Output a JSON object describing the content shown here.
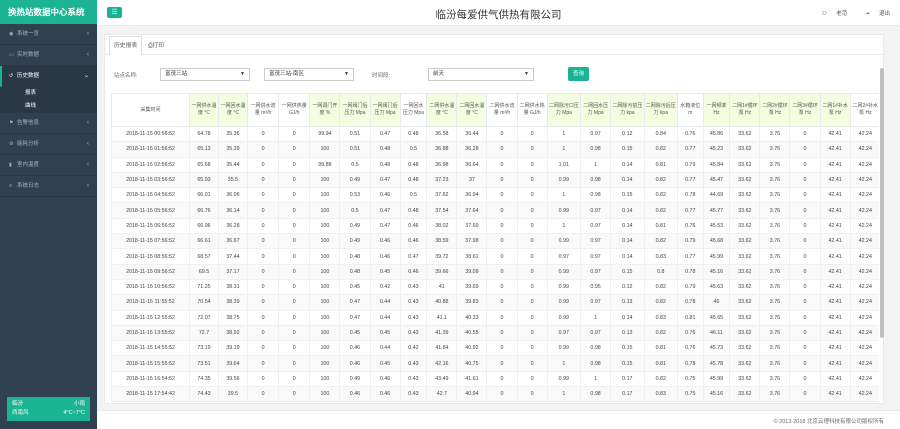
{
  "app": {
    "title": "换热站数据中心系统",
    "company": "临汾每爱供气供热有限公司"
  },
  "sidebar": {
    "items": [
      {
        "label": "系统一览",
        "icon": "eye-icon",
        "state": "closed"
      },
      {
        "label": "实时数据",
        "icon": "monitor-icon",
        "state": "closed"
      },
      {
        "label": "历史数据",
        "icon": "history-icon",
        "state": "open"
      },
      {
        "label": "告警信息",
        "icon": "alarm-icon",
        "state": "closed"
      },
      {
        "label": "能耗分析",
        "icon": "gear-icon",
        "state": "closed"
      },
      {
        "label": "室内温度",
        "icon": "thermometer-icon",
        "state": "closed"
      },
      {
        "label": "系统日志",
        "icon": "list-icon",
        "state": "closed"
      }
    ],
    "subitems": [
      "报表",
      "曲线"
    ]
  },
  "weather": {
    "city": "临汾",
    "condition": "小雨",
    "wind": "西南风",
    "temp": "4°C~7°C"
  },
  "topbar": {
    "links": [
      {
        "label": "老范",
        "icon": "user-icon"
      },
      {
        "label": "退出",
        "icon": "logout-icon"
      }
    ]
  },
  "panel": {
    "tabs": [
      {
        "label": "历史报表"
      },
      {
        "label": "打印",
        "icon": "print-icon"
      }
    ],
    "filters": {
      "station_label": "站点名称:",
      "station_value": "富茂三站",
      "zone_value": "富茂三站-南区",
      "period_label": "时间段:",
      "period_value": "前天",
      "query_label": "查询"
    }
  },
  "table": {
    "headers": [
      "采集时间",
      "一网供水温度 °C",
      "一网回水温度 °C",
      "一网供水流量 m³/h",
      "一网供热量 GJ/h",
      "一网调门开度 %",
      "一网阀门后压力 Mpa",
      "一网阀门后压力 Mpa",
      "一网回水压力 Mpa",
      "二网供水温度 °C",
      "二网回水温度 °C",
      "二网供水流量 m³/h",
      "二网供水热量 GJ/h",
      "二网除污口压力 Mpa",
      "二网回水压力 Mpa",
      "二网除污前压力 kpa",
      "二网除污后压力 kpa",
      "水箱液位 m",
      "一网频率 Hz",
      "二网1#循环泵 Hz",
      "二网2#循环泵 Hz",
      "二网3#循环泵 Hz",
      "二网1#补水泵 Hz",
      "二网2#补水泵 Hz"
    ],
    "rows": [
      [
        "2018-11-15 00:56:52",
        "64.78",
        "35.36",
        "0",
        "0",
        "99.94",
        "0.51",
        "0.47",
        "0.48",
        "36.58",
        "36.44",
        "0",
        "0",
        "1",
        "0.97",
        "0.12",
        "0.84",
        "0.76",
        "45.86",
        "33.62",
        "3.76",
        "0",
        "42.41",
        "42.24"
      ],
      [
        "2018-11-15 01:56:52",
        "65.13",
        "35.39",
        "0",
        "0",
        "100",
        "0.51",
        "0.48",
        "0.5",
        "36.88",
        "36.28",
        "0",
        "0",
        "1",
        "0.98",
        "0.15",
        "0.82",
        "0.77",
        "45.23",
        "33.62",
        "3.76",
        "0",
        "42.41",
        "42.24"
      ],
      [
        "2018-11-15 02:56:52",
        "65.68",
        "35.44",
        "0",
        "0",
        "99.88",
        "0.5",
        "0.48",
        "0.48",
        "36.98",
        "36.64",
        "0",
        "0",
        "1.01",
        "1",
        "0.14",
        "0.81",
        "0.79",
        "45.84",
        "33.62",
        "3.76",
        "0",
        "42.41",
        "42.24"
      ],
      [
        "2018-11-15 03:56:52",
        "65.93",
        "35.5",
        "0",
        "0",
        "100",
        "0.49",
        "0.47",
        "0.48",
        "37.23",
        "37",
        "0",
        "0",
        "0.99",
        "0.98",
        "0.14",
        "0.82",
        "0.77",
        "45.47",
        "33.62",
        "3.76",
        "0",
        "42.41",
        "42.24"
      ],
      [
        "2018-11-15 04:56:52",
        "66.01",
        "36.06",
        "0",
        "0",
        "100",
        "0.53",
        "0.46",
        "0.5",
        "37.62",
        "36.94",
        "0",
        "0",
        "1",
        "0.98",
        "0.15",
        "0.82",
        "0.78",
        "44.69",
        "33.62",
        "3.76",
        "0",
        "42.41",
        "42.24"
      ],
      [
        "2018-11-15 05:56:52",
        "66.76",
        "36.14",
        "0",
        "0",
        "100",
        "0.5",
        "0.47",
        "0.48",
        "37.54",
        "37.64",
        "0",
        "0",
        "0.99",
        "0.97",
        "0.14",
        "0.82",
        "0.77",
        "45.77",
        "33.62",
        "3.76",
        "0",
        "42.41",
        "42.24"
      ],
      [
        "2018-11-15 06:56:52",
        "66.96",
        "36.28",
        "0",
        "0",
        "100",
        "0.49",
        "0.47",
        "0.46",
        "38.02",
        "37.69",
        "0",
        "0",
        "1",
        "0.97",
        "0.14",
        "0.81",
        "0.76",
        "45.53",
        "33.62",
        "3.76",
        "0",
        "42.41",
        "42.24"
      ],
      [
        "2018-11-15 07:56:52",
        "66.61",
        "36.67",
        "0",
        "0",
        "100",
        "0.49",
        "0.46",
        "0.46",
        "38.59",
        "37.98",
        "0",
        "0",
        "0.99",
        "0.97",
        "0.14",
        "0.82",
        "0.79",
        "45.68",
        "33.62",
        "3.76",
        "0",
        "42.41",
        "42.24"
      ],
      [
        "2018-11-15 08:56:52",
        "68.57",
        "37.44",
        "0",
        "0",
        "100",
        "0.48",
        "0.46",
        "0.47",
        "39.72",
        "38.61",
        "0",
        "0",
        "0.97",
        "0.97",
        "0.14",
        "0.83",
        "0.77",
        "45.99",
        "33.62",
        "3.76",
        "0",
        "42.41",
        "42.24"
      ],
      [
        "2018-11-15 09:56:52",
        "69.5",
        "37.17",
        "0",
        "0",
        "100",
        "0.48",
        "0.45",
        "0.46",
        "39.66",
        "39.09",
        "0",
        "0",
        "0.99",
        "0.97",
        "0.15",
        "0.8",
        "0.78",
        "45.16",
        "33.62",
        "3.76",
        "0",
        "42.41",
        "42.24"
      ],
      [
        "2018-11-15 10:56:52",
        "71.25",
        "38.31",
        "0",
        "0",
        "100",
        "0.45",
        "0.42",
        "0.43",
        "41",
        "39.69",
        "0",
        "0",
        "0.99",
        "0.95",
        "0.12",
        "0.82",
        "0.79",
        "45.63",
        "33.62",
        "3.76",
        "0",
        "42.41",
        "42.24"
      ],
      [
        "2018-11-15 11:55:52",
        "70.54",
        "38.39",
        "0",
        "0",
        "100",
        "0.47",
        "0.44",
        "0.43",
        "40.88",
        "39.83",
        "0",
        "0",
        "0.99",
        "0.97",
        "0.13",
        "0.82",
        "0.78",
        "46",
        "33.62",
        "3.76",
        "0",
        "42.41",
        "42.24"
      ],
      [
        "2018-11-15 12:55:52",
        "72.07",
        "38.75",
        "0",
        "0",
        "100",
        "0.47",
        "0.44",
        "0.43",
        "41.1",
        "40.33",
        "0",
        "0",
        "0.99",
        "1",
        "0.14",
        "0.83",
        "0.81",
        "45.65",
        "33.62",
        "3.76",
        "0",
        "42.41",
        "42.24"
      ],
      [
        "2018-11-15 13:55:52",
        "72.7",
        "38.92",
        "0",
        "0",
        "100",
        "0.45",
        "0.45",
        "0.43",
        "41.39",
        "40.55",
        "0",
        "0",
        "0.97",
        "0.97",
        "0.13",
        "0.82",
        "0.76",
        "46.11",
        "33.62",
        "3.76",
        "0",
        "42.41",
        "42.24"
      ],
      [
        "2018-11-15 14:55:52",
        "73.19",
        "39.19",
        "0",
        "0",
        "100",
        "0.46",
        "0.44",
        "0.42",
        "41.84",
        "40.92",
        "0",
        "0",
        "0.99",
        "0.98",
        "0.15",
        "0.81",
        "0.76",
        "45.73",
        "33.62",
        "3.76",
        "0",
        "42.41",
        "42.24"
      ],
      [
        "2018-11-15 15:55:52",
        "73.51",
        "39.64",
        "0",
        "0",
        "100",
        "0.46",
        "0.45",
        "0.43",
        "42.16",
        "40.75",
        "0",
        "0",
        "1",
        "0.98",
        "0.15",
        "0.81",
        "0.78",
        "45.78",
        "33.62",
        "3.76",
        "0",
        "42.41",
        "42.24"
      ],
      [
        "2018-11-15 16:54:52",
        "74.35",
        "39.56",
        "0",
        "0",
        "100",
        "0.49",
        "0.46",
        "0.43",
        "43.49",
        "41.61",
        "0",
        "0",
        "0.99",
        "1",
        "0.17",
        "0.82",
        "0.75",
        "45.99",
        "33.62",
        "3.76",
        "0",
        "42.41",
        "42.24"
      ],
      [
        "2018-11-15 17:54:42",
        "74.43",
        "39.5",
        "0",
        "0",
        "100",
        "0.46",
        "0.46",
        "0.43",
        "42.7",
        "40.94",
        "0",
        "0",
        "1",
        "0.98",
        "0.17",
        "0.83",
        "0.75",
        "45.16",
        "33.62",
        "3.76",
        "0",
        "42.41",
        "42.24"
      ]
    ]
  },
  "footer": {
    "copyright": "© 2013-2018 北京云理科技有限公司版权所有"
  }
}
